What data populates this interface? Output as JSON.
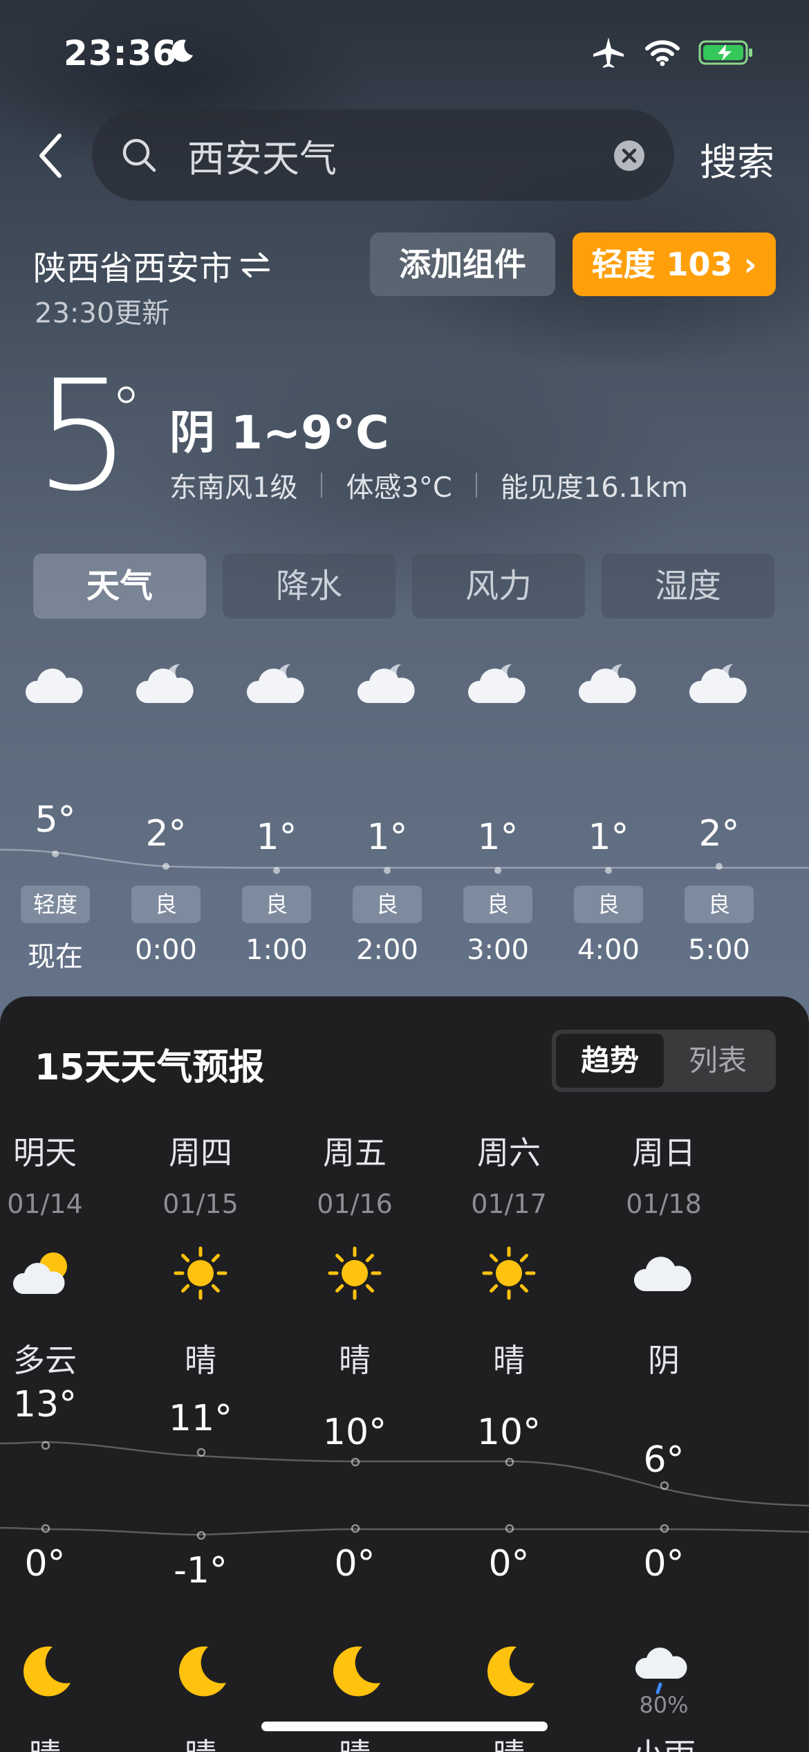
{
  "status_bar": {
    "time": "23:36"
  },
  "search": {
    "back_label": "",
    "query": "西安天气",
    "submit_label": "搜索"
  },
  "location": {
    "name": "陕西省西安市",
    "updated": "23:30更新"
  },
  "buttons": {
    "add_widget": "添加组件",
    "aqi": "轻度 103 ›"
  },
  "current": {
    "temp": "5",
    "degree": "°",
    "condition": "阴  1~9°C",
    "wind": "东南风1级",
    "feels_like": "体感3°C",
    "visibility": "能见度16.1km"
  },
  "tabs": [
    "天气",
    "降水",
    "风力",
    "湿度"
  ],
  "hourly": [
    {
      "time": "现在",
      "temp": "5°",
      "aqi": "轻度",
      "icon": "cloud-icon"
    },
    {
      "time": "0:00",
      "temp": "2°",
      "aqi": "良",
      "icon": "cloudy-night-icon"
    },
    {
      "time": "1:00",
      "temp": "1°",
      "aqi": "良",
      "icon": "cloudy-night-icon"
    },
    {
      "time": "2:00",
      "temp": "1°",
      "aqi": "良",
      "icon": "cloudy-night-icon"
    },
    {
      "time": "3:00",
      "temp": "1°",
      "aqi": "良",
      "icon": "cloudy-night-icon"
    },
    {
      "time": "4:00",
      "temp": "1°",
      "aqi": "良",
      "icon": "cloudy-night-icon"
    },
    {
      "time": "5:00",
      "temp": "2°",
      "aqi": "良",
      "icon": "cloudy-night-icon"
    }
  ],
  "forecast": {
    "title": "15天天气预报",
    "view_options": [
      "趋势",
      "列表"
    ],
    "days": [
      {
        "name": "明天",
        "date": "01/14",
        "day_icon": "partly-cloudy-icon",
        "day_cond": "多云",
        "hi": "13°",
        "lo": "0°",
        "night_icon": "moon-icon",
        "night_cond": "晴"
      },
      {
        "name": "周四",
        "date": "01/15",
        "day_icon": "sun-icon",
        "day_cond": "晴",
        "hi": "11°",
        "lo": "-1°",
        "night_icon": "moon-icon",
        "night_cond": "晴"
      },
      {
        "name": "周五",
        "date": "01/16",
        "day_icon": "sun-icon",
        "day_cond": "晴",
        "hi": "10°",
        "lo": "0°",
        "night_icon": "moon-icon",
        "night_cond": "晴"
      },
      {
        "name": "周六",
        "date": "01/17",
        "day_icon": "sun-icon",
        "day_cond": "晴",
        "hi": "10°",
        "lo": "0°",
        "night_icon": "moon-icon",
        "night_cond": "晴"
      },
      {
        "name": "周日",
        "date": "01/18",
        "day_icon": "cloud-icon",
        "day_cond": "阴",
        "hi": "6°",
        "lo": "0°",
        "night_icon": "rain-cloud-icon",
        "night_cond": "小雨",
        "night_pop": "80%"
      }
    ]
  },
  "colors": {
    "accent_orange": "#ff9f0a",
    "sheet_bg": "#1f1f21",
    "sun_yellow": "#ffc20e"
  }
}
